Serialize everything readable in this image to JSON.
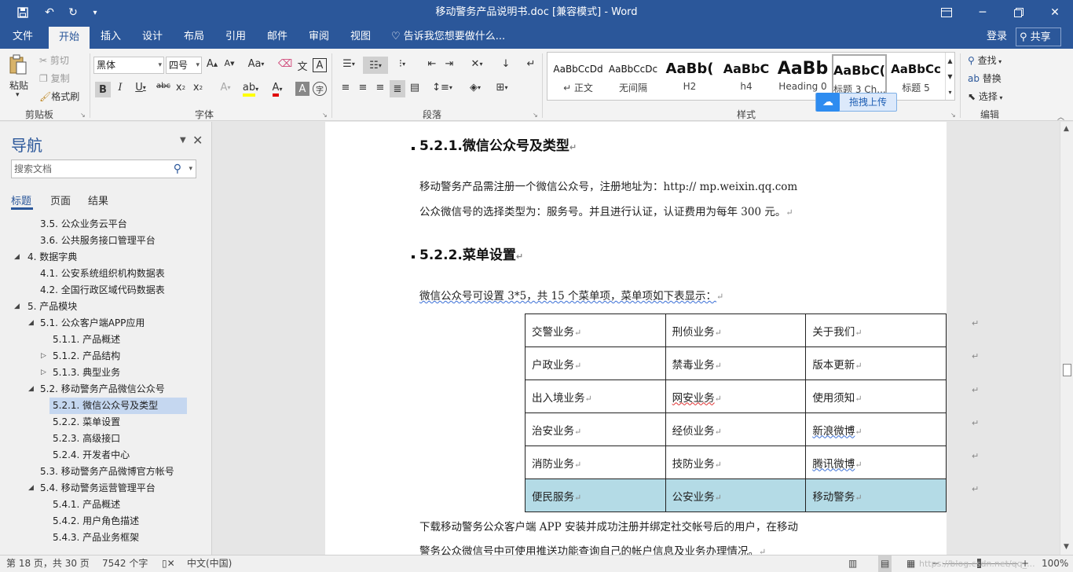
{
  "titlebar": {
    "title": "移动警务产品说明书.doc [兼容模式] - Word",
    "save_icon": "save-icon",
    "undo_icon": "undo-icon",
    "redo_icon": "redo-icon",
    "customize_icon": "customize-icon"
  },
  "tabs": [
    "文件",
    "开始",
    "插入",
    "设计",
    "布局",
    "引用",
    "邮件",
    "审阅",
    "视图"
  ],
  "tell_me": "告诉我您想要做什么...",
  "account": {
    "login": "登录",
    "share": "共享"
  },
  "ribbon": {
    "clipboard": {
      "paste": "粘贴",
      "cut": "剪切",
      "copy": "复制",
      "format_painter": "格式刷",
      "label": "剪贴板"
    },
    "font": {
      "name": "黑体",
      "size": "四号",
      "label": "字体",
      "aa": "Aa"
    },
    "paragraph": {
      "label": "段落"
    },
    "styles": {
      "label": "样式",
      "items": [
        {
          "sample": "AaBbCcDd",
          "name": "↵ 正文"
        },
        {
          "sample": "AaBbCcDc",
          "name": "无间隔"
        },
        {
          "sample": "AaBb(",
          "name": "H2"
        },
        {
          "sample": "AaBbC",
          "name": "h4"
        },
        {
          "sample": "AaBb",
          "name": "Heading 0"
        },
        {
          "sample": "AaBbC(",
          "name": "标题 3 Ch..."
        },
        {
          "sample": "AaBbCc",
          "name": "标题 5"
        }
      ]
    },
    "editing": {
      "find": "查找",
      "replace": "替换",
      "select": "选择",
      "label": "编辑"
    },
    "upload": "拖拽上传"
  },
  "nav": {
    "title": "导航",
    "search_placeholder": "搜索文档",
    "tabs": [
      "标题",
      "页面",
      "结果"
    ],
    "items": [
      {
        "text": "3.5. 公众业务云平台"
      },
      {
        "text": "3.6. 公共服务接口管理平台"
      },
      {
        "text": "4. 数据字典"
      },
      {
        "text": "4.1. 公安系统组织机构数据表"
      },
      {
        "text": "4.2. 全国行政区域代码数据表"
      },
      {
        "text": "5. 产品模块"
      },
      {
        "text": "5.1. 公众客户端APP应用"
      },
      {
        "text": "5.1.1. 产品概述"
      },
      {
        "text": "5.1.2. 产品结构"
      },
      {
        "text": "5.1.3. 典型业务"
      },
      {
        "text": "5.2. 移动警务产品微信公众号"
      },
      {
        "text": "5.2.1. 微信公众号及类型"
      },
      {
        "text": "5.2.2. 菜单设置"
      },
      {
        "text": "5.2.3. 高级接口"
      },
      {
        "text": "5.2.4. 开发者中心"
      },
      {
        "text": "5.3. 移动警务产品微博官方帐号"
      },
      {
        "text": "5.4. 移动警务运营管理平台"
      },
      {
        "text": "5.4.1. 产品概述"
      },
      {
        "text": "5.4.2. 用户角色描述"
      },
      {
        "text": "5.4.3. 产品业务框架"
      }
    ]
  },
  "document": {
    "h1": "5.2.1.微信公众号及类型",
    "p1_line1": "移动警务产品需注册一个微信公众号，注册地址为：http:// mp.weixin.qq.com",
    "p1_line2": "公众微信号的选择类型为：服务号。并且进行认证，认证费用为每年 300 元。",
    "h2": "5.2.2.菜单设置",
    "p2": "微信公众号可设置 3*5，共 15 个菜单项，菜单项如下表显示：",
    "table": [
      [
        "交警业务",
        "刑侦业务",
        "关于我们"
      ],
      [
        "户政业务",
        "禁毒业务",
        "版本更新"
      ],
      [
        "出入境业务",
        "网安业务",
        "使用须知"
      ],
      [
        "治安业务",
        "经侦业务",
        "新浪微博"
      ],
      [
        "消防业务",
        "技防业务",
        "腾讯微博"
      ],
      [
        "便民服务",
        "公安业务",
        "移动警务"
      ]
    ],
    "p3_line1": "下载移动警务公众客户端 APP 安装并成功注册并绑定社交帐号后的用户，在移动",
    "p3_line2": "警务公众微信号中可使用推送功能查询自己的帐户信息及业务办理情况。"
  },
  "status": {
    "page": "第 18 页，共 30 页",
    "words": "7542 个字",
    "lang": "中文(中国)",
    "zoom": "100%",
    "watermark": "https://blog.csdn.net/qq_..."
  }
}
